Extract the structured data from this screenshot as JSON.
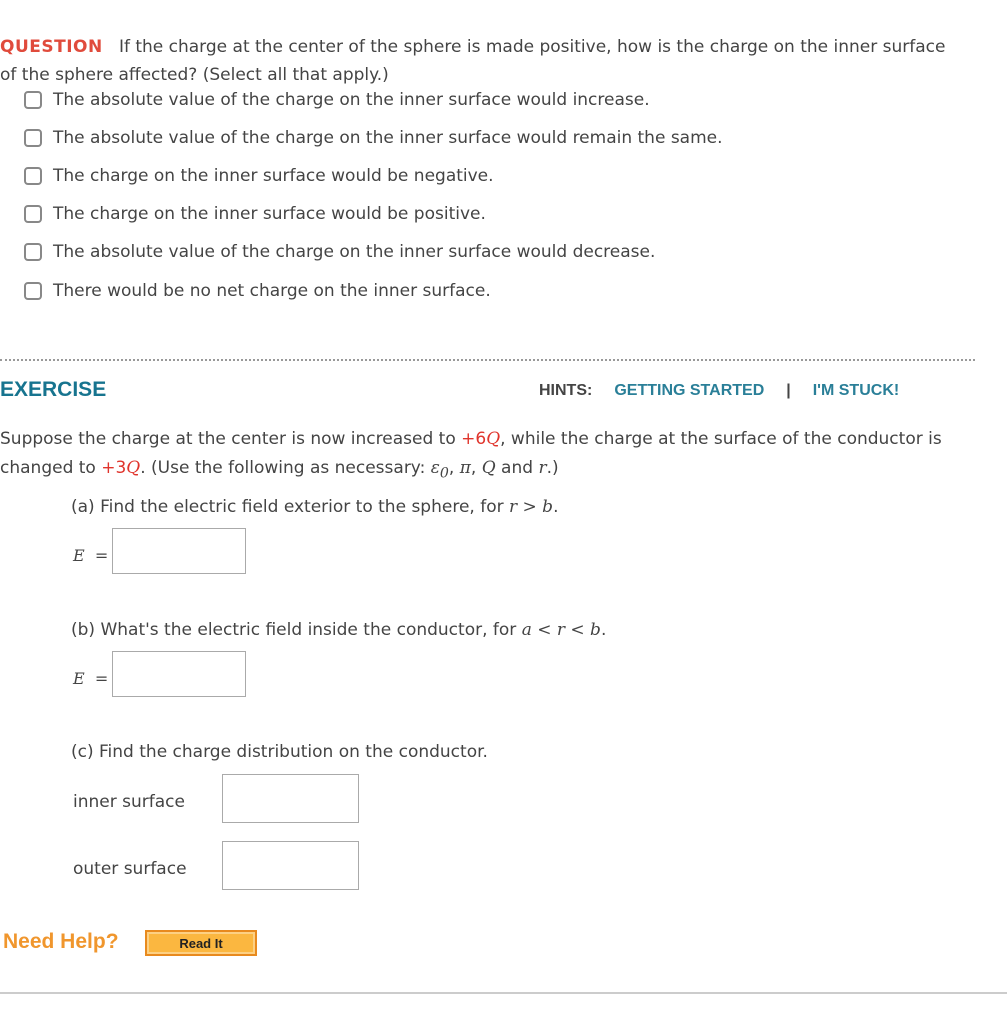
{
  "question": {
    "label": "QUESTION",
    "text": "If the charge at the center of the sphere is made positive, how is the charge on the inner surface of the sphere affected? (Select all that apply.)",
    "options": [
      {
        "label": "The absolute value of the charge on the inner surface would increase.",
        "checked": false
      },
      {
        "label": "The absolute value of the charge on the inner surface would remain the same.",
        "checked": false
      },
      {
        "label": "The charge on the inner surface would be negative.",
        "checked": false
      },
      {
        "label": "The charge on the inner surface would be positive.",
        "checked": false
      },
      {
        "label": "The absolute value of the charge on the inner surface would decrease.",
        "checked": false
      },
      {
        "label": "There would be no net charge on the inner surface.",
        "checked": false
      }
    ]
  },
  "exercise": {
    "title": "EXERCISE",
    "hints_label": "HINTS:",
    "hint_links": [
      "GETTING STARTED",
      "I'M STUCK!"
    ],
    "separator": "|",
    "intro": {
      "t1": "Suppose the charge at the center is now increased to ",
      "q1": "+6",
      "Q": "Q",
      "t2": ", while the charge at the surface of the conductor is changed to ",
      "q2": "+3",
      "t3": ". (Use the following as necessary: ",
      "eps": "ε",
      "eps_sub": "0",
      "pi": "π",
      "comma": ", ",
      "and": " and ",
      "r": "r",
      "end": ".)"
    },
    "part_a": {
      "text": "(a) Find the electric field exterior to the sphere, for ",
      "cond": "r > b",
      "eq_label": "E  =",
      "value": ""
    },
    "part_b": {
      "text": "(b) What's the electric field inside the conductor, for ",
      "cond": "a < r < b",
      "eq_label": "E  =",
      "value": ""
    },
    "part_c": {
      "text": "(c) Find the charge distribution on the conductor.",
      "inner_label": "inner surface",
      "outer_label": "outer surface",
      "inner_value": "",
      "outer_value": ""
    }
  },
  "help": {
    "label": "Need Help?",
    "read_it": "Read It"
  }
}
